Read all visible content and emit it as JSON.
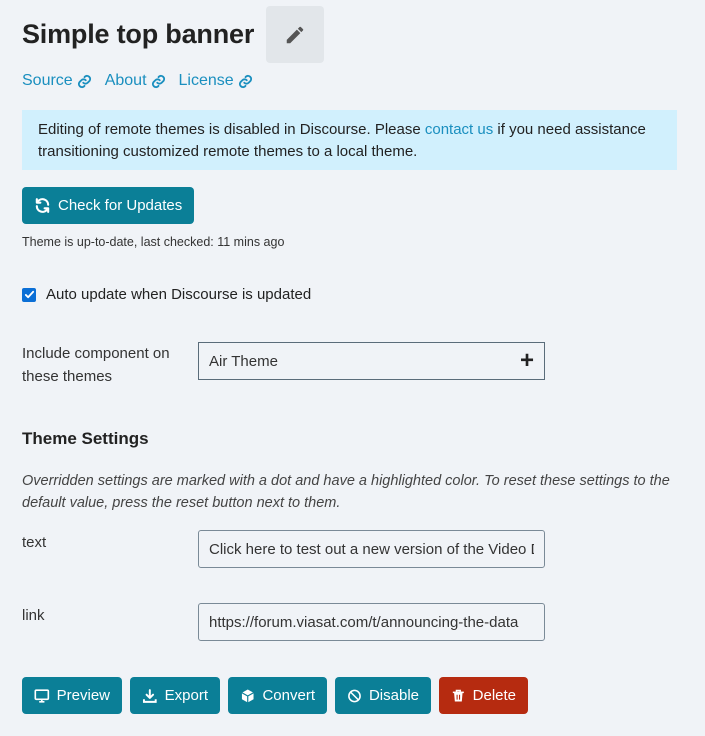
{
  "header": {
    "title": "Simple top banner",
    "edit_icon": "pencil-icon"
  },
  "links": [
    {
      "label": "Source",
      "icon": "link-icon"
    },
    {
      "label": "About",
      "icon": "link-icon"
    },
    {
      "label": "License",
      "icon": "link-icon"
    }
  ],
  "notice": {
    "text_before": "Editing of remote themes is disabled in Discourse. Please ",
    "link": "contact us",
    "text_after": " if you need assistance transitioning customized remote themes to a local theme."
  },
  "updates": {
    "button_label": "Check for Updates",
    "icon": "refresh-icon",
    "status": "Theme is up-to-date, last checked: 11 mins ago"
  },
  "auto_update": {
    "label": "Auto update when Discourse is updated",
    "checked": true
  },
  "include_component": {
    "label": "Include component on these themes",
    "value": "Air Theme",
    "add_icon": "plus-icon"
  },
  "theme_settings": {
    "title": "Theme Settings",
    "description": "Overridden settings are marked with a dot and have a highlighted color. To reset these settings to the default value, press the reset button next to them.",
    "settings": [
      {
        "name": "text",
        "value": "Click here to test out a new version of the Video Data"
      },
      {
        "name": "link",
        "value": "https://forum.viasat.com/t/announcing-the-data"
      }
    ]
  },
  "actions": [
    {
      "label": "Preview",
      "icon": "monitor-icon"
    },
    {
      "label": "Export",
      "icon": "download-icon"
    },
    {
      "label": "Convert",
      "icon": "cube-icon"
    },
    {
      "label": "Disable",
      "icon": "ban-icon"
    },
    {
      "label": "Delete",
      "icon": "trash-icon"
    }
  ],
  "colors": {
    "primary": "#0b7f97",
    "danger": "#b62b10",
    "link": "#1a8fbf",
    "notice_bg": "#d1f0fd",
    "background": "#f0f3f7"
  }
}
